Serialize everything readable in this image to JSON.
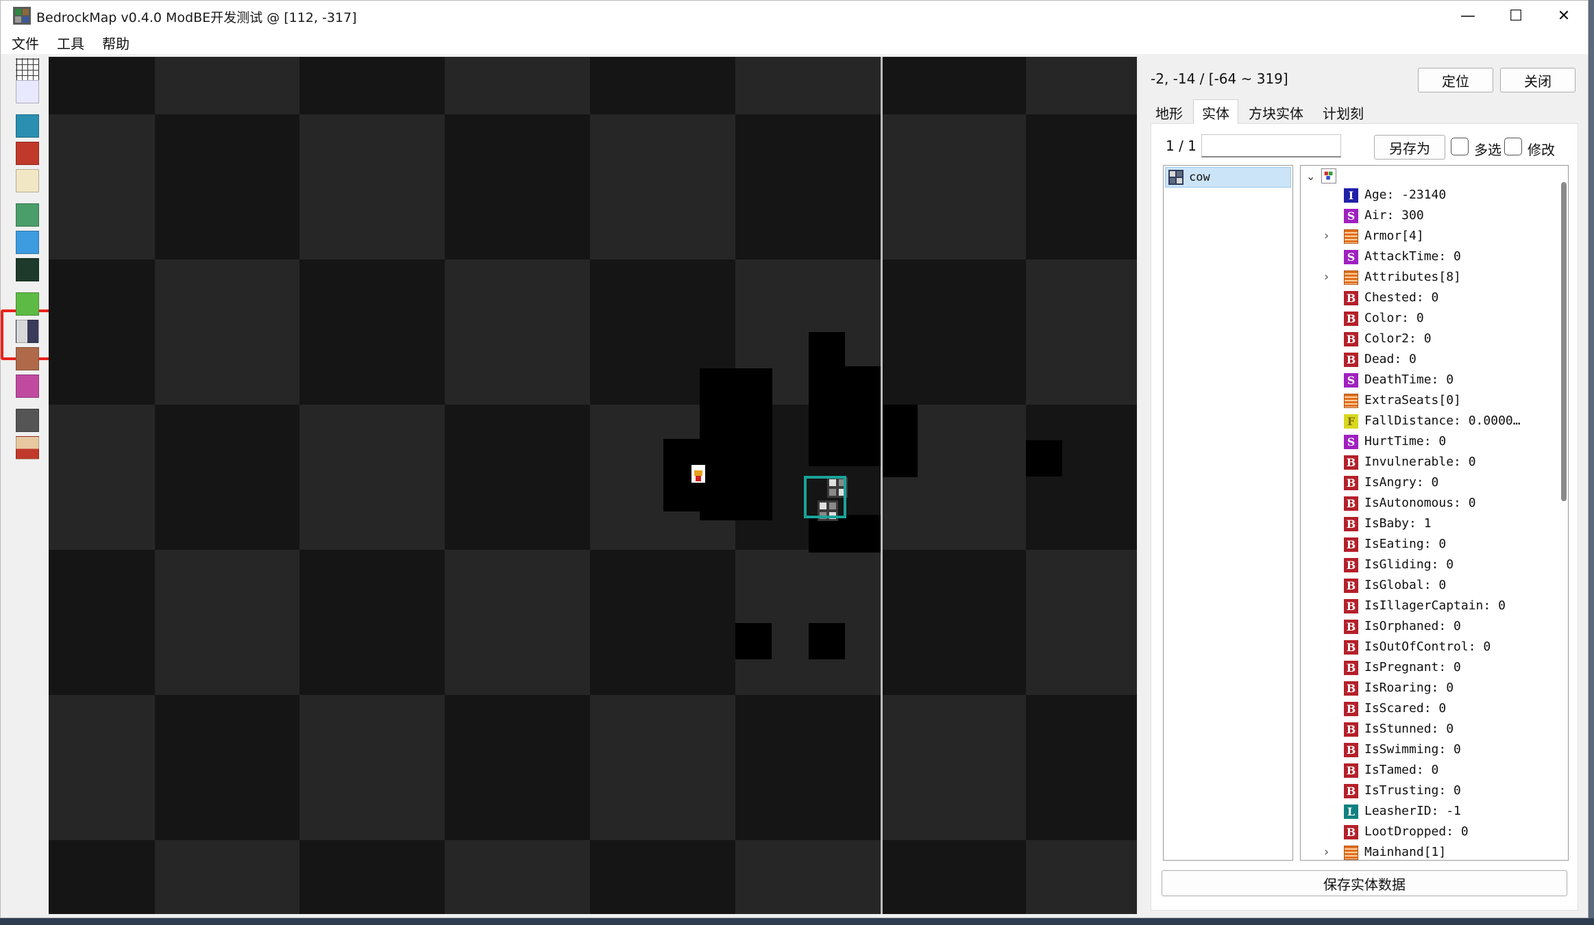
{
  "window": {
    "title": "BedrockMap v0.4.0 ModBE开发测试 @  [112, -317]",
    "min_glyph": "—",
    "max_glyph": "☐",
    "close_glyph": "✕"
  },
  "menu": [
    "文件",
    "工具",
    "帮助"
  ],
  "tools": [
    {
      "icon": "grid-icon",
      "color": "#ffffff"
    },
    {
      "icon": "map-ruler-icon",
      "color": "#e8e8ff"
    },
    {
      "icon": "globe-block-icon",
      "color": "#2a8fb0"
    },
    {
      "icon": "red-block-icon",
      "color": "#c0392b"
    },
    {
      "icon": "dice-icon",
      "color": "#f2e7c4"
    },
    {
      "icon": "landscape-icon",
      "color": "#4a9e6a"
    },
    {
      "icon": "colored-map-icon",
      "color": "#3d9be0"
    },
    {
      "icon": "tree-biome-icon",
      "color": "#1d3a2a"
    },
    {
      "icon": "green-slime-icon",
      "color": "#5dbb45"
    },
    {
      "icon": "entity-icon",
      "color": "#7a5a8a"
    },
    {
      "icon": "villager-icon",
      "color": "#b06a4a"
    },
    {
      "icon": "mob-icon",
      "color": "#c04aa0"
    },
    {
      "icon": "cauldron-icon",
      "color": "#555555"
    },
    {
      "icon": "nbt-icon",
      "color": "#e8c8a0"
    }
  ],
  "panel": {
    "coord_readout": "-2, -14 / [-64 ~ 319]",
    "locate_button": "定位",
    "close_button": "关闭",
    "tabs": [
      {
        "label": "地形",
        "active": false
      },
      {
        "label": "实体",
        "active": true
      },
      {
        "label": "方块实体",
        "active": false
      },
      {
        "label": "计划刻",
        "active": false
      }
    ],
    "page_count": "1 / 1",
    "filter_value": "",
    "save_as_button": "另存为",
    "multi_select_label": "多选",
    "multi_select_checked": false,
    "edit_label": "修改",
    "edit_checked": false,
    "entities": [
      {
        "name": "cow",
        "icon": "cow-icon",
        "selected": true
      }
    ],
    "nbt_tree": [
      {
        "tag": "I",
        "text": "Age: -23140",
        "expandable": false
      },
      {
        "tag": "S",
        "text": "Air: 300",
        "expandable": false
      },
      {
        "tag": "L",
        "text": "Armor[4]",
        "expandable": true,
        "list": true
      },
      {
        "tag": "S",
        "text": "AttackTime: 0",
        "expandable": false
      },
      {
        "tag": "L",
        "text": "Attributes[8]",
        "expandable": true,
        "list": true
      },
      {
        "tag": "B",
        "text": "Chested: 0",
        "expandable": false
      },
      {
        "tag": "B",
        "text": "Color: 0",
        "expandable": false
      },
      {
        "tag": "B",
        "text": "Color2: 0",
        "expandable": false
      },
      {
        "tag": "B",
        "text": "Dead: 0",
        "expandable": false
      },
      {
        "tag": "S",
        "text": "DeathTime: 0",
        "expandable": false
      },
      {
        "tag": "L",
        "text": "ExtraSeats[0]",
        "expandable": false,
        "list": true
      },
      {
        "tag": "F",
        "text": "FallDistance: 0.0000…",
        "expandable": false
      },
      {
        "tag": "S",
        "text": "HurtTime: 0",
        "expandable": false
      },
      {
        "tag": "B",
        "text": "Invulnerable: 0",
        "expandable": false
      },
      {
        "tag": "B",
        "text": "IsAngry: 0",
        "expandable": false
      },
      {
        "tag": "B",
        "text": "IsAutonomous: 0",
        "expandable": false
      },
      {
        "tag": "B",
        "text": "IsBaby: 1",
        "expandable": false
      },
      {
        "tag": "B",
        "text": "IsEating: 0",
        "expandable": false
      },
      {
        "tag": "B",
        "text": "IsGliding: 0",
        "expandable": false
      },
      {
        "tag": "B",
        "text": "IsGlobal: 0",
        "expandable": false
      },
      {
        "tag": "B",
        "text": "IsIllagerCaptain: 0",
        "expandable": false
      },
      {
        "tag": "B",
        "text": "IsOrphaned: 0",
        "expandable": false
      },
      {
        "tag": "B",
        "text": "IsOutOfControl: 0",
        "expandable": false
      },
      {
        "tag": "B",
        "text": "IsPregnant: 0",
        "expandable": false
      },
      {
        "tag": "B",
        "text": "IsRoaring: 0",
        "expandable": false
      },
      {
        "tag": "B",
        "text": "IsScared: 0",
        "expandable": false
      },
      {
        "tag": "B",
        "text": "IsStunned: 0",
        "expandable": false
      },
      {
        "tag": "B",
        "text": "IsSwimming: 0",
        "expandable": false
      },
      {
        "tag": "B",
        "text": "IsTamed: 0",
        "expandable": false
      },
      {
        "tag": "B",
        "text": "IsTrusting: 0",
        "expandable": false
      },
      {
        "tag": "L",
        "text": "LeasherID: -1",
        "expandable": false,
        "long": true
      },
      {
        "tag": "B",
        "text": "LootDropped: 0",
        "expandable": false
      },
      {
        "tag": "L",
        "text": "Mainhand[1]",
        "expandable": true,
        "list": true
      }
    ],
    "save_entity_button": "保存实体数据"
  },
  "colors": {
    "tag_B": "#b4202a",
    "tag_S": "#a020c0",
    "tag_I": "#2020a8",
    "tag_F": "#d8d820",
    "tag_LONG": "#108080",
    "tag_LIST": "#e07020",
    "selection_box": "#1aa39a",
    "highlight_box": "#e8221c"
  }
}
